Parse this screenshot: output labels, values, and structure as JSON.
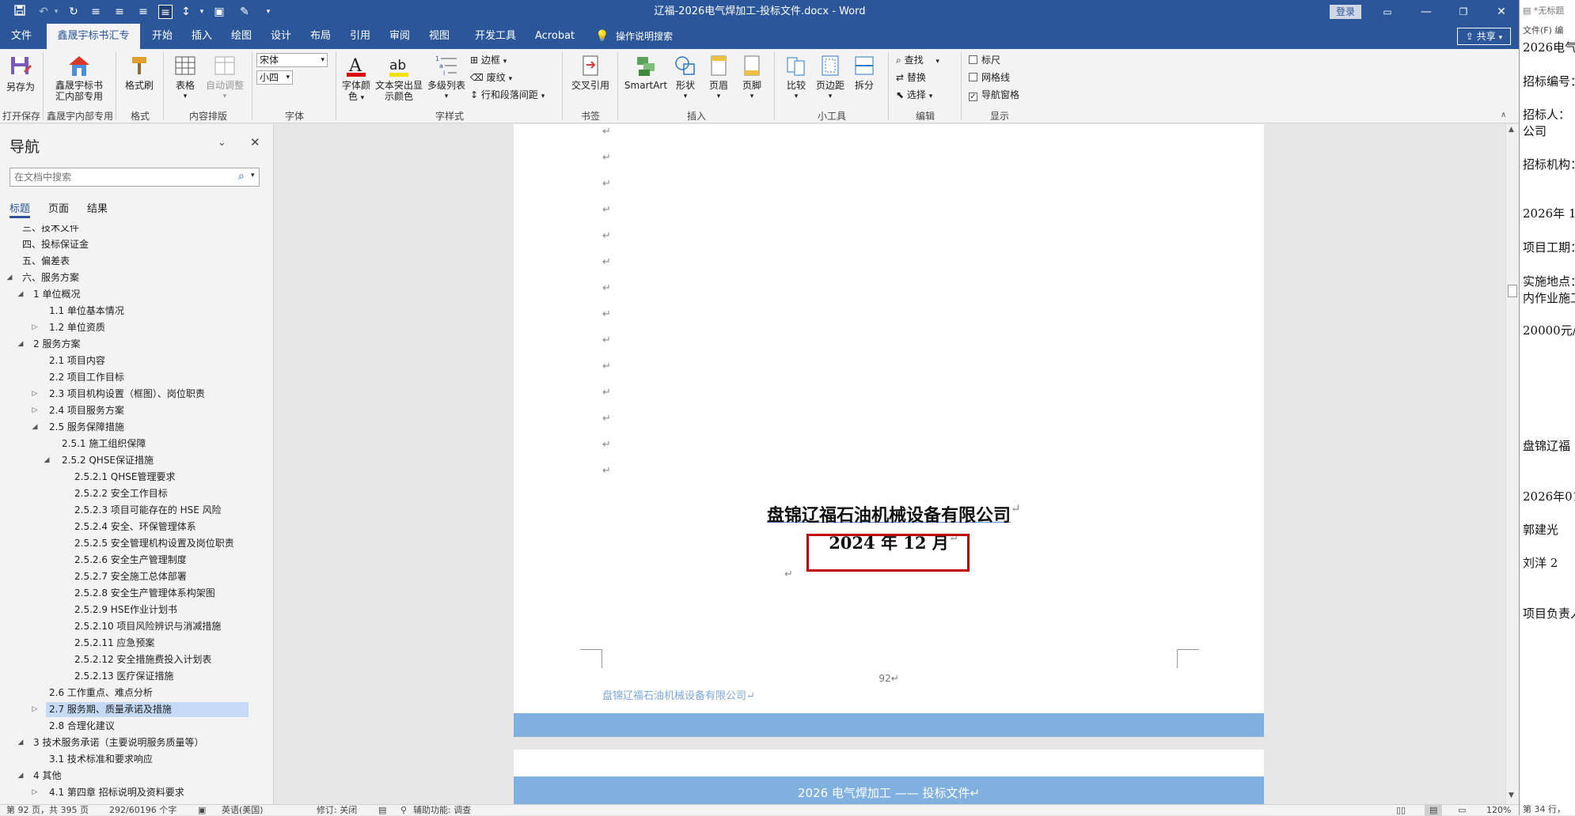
{
  "window": {
    "title": "辽福-2026电气焊加工-投标文件.docx  -  Word",
    "login_label": "登录",
    "share_label": "共享"
  },
  "tabs": [
    "文件",
    "鑫晟宇标书汇专用",
    "开始",
    "插入",
    "绘图",
    "设计",
    "布局",
    "引用",
    "审阅",
    "视图",
    "开发工具",
    "Acrobat"
  ],
  "active_tab": "鑫晟宇标书汇专用",
  "tell_me": "操作说明搜索",
  "ribbon": {
    "save_as": "另存为",
    "xsy_label": "鑫晟宇标书汇内部专用",
    "format_painter": "格式刷",
    "table": "表格",
    "auto_adjust": "自动调整",
    "font_name": "宋体",
    "font_size": "小四",
    "font_color": "字体颜色",
    "highlight": "文本突出显示颜色",
    "multilevel": "多级列表",
    "border": "边框",
    "strikethrough": "废纹",
    "line_spacing": "行和段落间距",
    "cross_ref": "交叉引用",
    "smartart": "SmartArt",
    "shapes": "形状",
    "header": "页眉",
    "footer": "页脚",
    "compare": "比较",
    "margins": "页边距",
    "split": "拆分",
    "find": "查找",
    "replace": "替换",
    "select": "选择",
    "ruler": "标尺",
    "gridlines": "网格线",
    "nav_pane": "导航窗格",
    "ruler_checked": false,
    "gridlines_checked": false,
    "nav_pane_checked": true,
    "groups": {
      "open_save": "打开保存",
      "xsy_internal": "鑫晟宇内部专用",
      "format": "格式",
      "content_layout": "内容排版",
      "font": "字体",
      "paragraph": "字样式",
      "bookmark": "书签",
      "insert": "插入",
      "tools": "小工具",
      "edit": "编辑",
      "display": "显示"
    }
  },
  "nav": {
    "title": "导航",
    "search_placeholder": "在文档中搜索",
    "tabs": [
      "标题",
      "页面",
      "结果"
    ],
    "active_tab": "标题",
    "items": [
      {
        "label": "三、技术文件",
        "indent": 0,
        "toggle": ""
      },
      {
        "label": "四、投标保证金",
        "indent": 0,
        "toggle": ""
      },
      {
        "label": "五、偏差表",
        "indent": 0,
        "toggle": ""
      },
      {
        "label": "六、服务方案",
        "indent": 0,
        "toggle": "open"
      },
      {
        "label": "1 单位概况",
        "indent": 1,
        "toggle": "open"
      },
      {
        "label": "1.1 单位基本情况",
        "indent": 2,
        "toggle": ""
      },
      {
        "label": "1.2 单位资质",
        "indent": 2,
        "toggle": "closed"
      },
      {
        "label": "2 服务方案",
        "indent": 1,
        "toggle": "open"
      },
      {
        "label": "2.1 项目内容",
        "indent": 2,
        "toggle": ""
      },
      {
        "label": "2.2 项目工作目标",
        "indent": 2,
        "toggle": ""
      },
      {
        "label": "2.3 项目机构设置（框图）、岗位职责",
        "indent": 2,
        "toggle": "closed"
      },
      {
        "label": "2.4 项目服务方案",
        "indent": 2,
        "toggle": "closed"
      },
      {
        "label": "2.5 服务保障措施",
        "indent": 2,
        "toggle": "open"
      },
      {
        "label": "2.5.1 施工组织保障",
        "indent": 3,
        "toggle": ""
      },
      {
        "label": "2.5.2 QHSE保证措施",
        "indent": 3,
        "toggle": "open"
      },
      {
        "label": "2.5.2.1 QHSE管理要求",
        "indent": 4,
        "toggle": ""
      },
      {
        "label": "2.5.2.2 安全工作目标",
        "indent": 4,
        "toggle": ""
      },
      {
        "label": "2.5.2.3 项目可能存在的 HSE 风险",
        "indent": 4,
        "toggle": ""
      },
      {
        "label": "2.5.2.4 安全、环保管理体系",
        "indent": 4,
        "toggle": ""
      },
      {
        "label": "2.5.2.5 安全管理机构设置及岗位职责",
        "indent": 4,
        "toggle": ""
      },
      {
        "label": "2.5.2.6 安全生产管理制度",
        "indent": 4,
        "toggle": ""
      },
      {
        "label": "2.5.2.7 安全施工总体部署",
        "indent": 4,
        "toggle": ""
      },
      {
        "label": "2.5.2.8 安全生产管理体系构架图",
        "indent": 4,
        "toggle": ""
      },
      {
        "label": "2.5.2.9 HSE作业计划书",
        "indent": 4,
        "toggle": ""
      },
      {
        "label": "2.5.2.10 项目风险辨识与消减措施",
        "indent": 4,
        "toggle": ""
      },
      {
        "label": "2.5.2.11 应急预案",
        "indent": 4,
        "toggle": ""
      },
      {
        "label": "2.5.2.12 安全措施费投入计划表",
        "indent": 4,
        "toggle": ""
      },
      {
        "label": "2.5.2.13 医疗保证措施",
        "indent": 4,
        "toggle": ""
      },
      {
        "label": "2.6 工作重点、难点分析",
        "indent": 2,
        "toggle": ""
      },
      {
        "label": "2.7 服务期、质量承诺及措施",
        "indent": 2,
        "toggle": "closed",
        "selected": true
      },
      {
        "label": "2.8 合理化建议",
        "indent": 2,
        "toggle": ""
      },
      {
        "label": "3 技术服务承诺（主要说明服务质量等）",
        "indent": 1,
        "toggle": "open"
      },
      {
        "label": "3.1 技术标准和要求响应",
        "indent": 2,
        "toggle": ""
      },
      {
        "label": "4 其他",
        "indent": 1,
        "toggle": "open"
      },
      {
        "label": "4.1 第四章 招标说明及资料要求",
        "indent": 2,
        "toggle": "closed"
      }
    ]
  },
  "document": {
    "company": "盘锦辽福石油机械设备有限公司",
    "date": "2024 年 12 月",
    "page_number": "92",
    "footer_text": "盘锦辽福石油机械设备有限公司",
    "next_header": "2026 电气焊加工 —— 投标文件",
    "para_mark": "↵"
  },
  "status": {
    "page": "第 92 页，共 395 页",
    "words": "292/60196 个字",
    "language": "英语(美国)",
    "track_changes": "修订: 关闭",
    "accessibility": "辅助功能: 调查",
    "zoom": "120%"
  },
  "right_pane": {
    "title": "*无标题",
    "menu": "文件(F)  编",
    "lines": [
      "2026电气",
      "招标编号：",
      "招标人：",
      "公司",
      "招标机构：",
      "2026年 1",
      "项目工期：",
      "实施地点：",
      "内作业施工",
      "20000元/",
      "盘锦辽福",
      "2026年01",
      "郭建光",
      "刘洋    2",
      "项目负责人"
    ],
    "status": "第 34 行，"
  },
  "colors": {
    "accent": "#2b579a",
    "band": "#7fb0de",
    "highlight_box": "#c00000",
    "selection": "#c5dbf5"
  }
}
